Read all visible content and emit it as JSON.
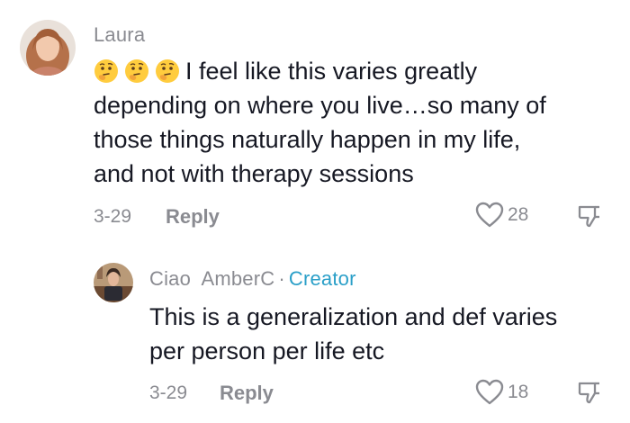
{
  "comments": [
    {
      "username": "Laura",
      "emoji_icons": [
        "thinking-face-emoji",
        "thinking-face-emoji",
        "thinking-face-emoji"
      ],
      "text_lines": [
        "I feel like this varies greatly",
        "depending on where you live…so many of",
        "those things naturally happen in my life,",
        "and not with therapy sessions"
      ],
      "date": "3-29",
      "reply_label": "Reply",
      "likes": "28"
    }
  ],
  "replies": [
    {
      "username": "Ciao  AmberC",
      "separator": "·",
      "badge": "Creator",
      "text_lines": [
        "This is a generalization and def varies",
        "per person per life etc"
      ],
      "date": "3-29",
      "reply_label": "Reply",
      "likes": "18"
    }
  ],
  "colors": {
    "text": "#161823",
    "muted": "#8a8b91",
    "creator_badge": "#2a9fc8"
  }
}
